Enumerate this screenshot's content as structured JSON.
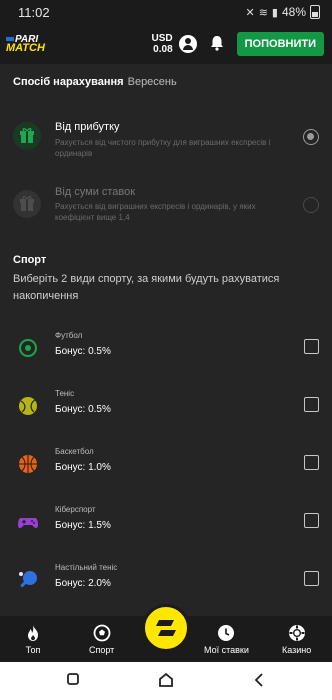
{
  "status_bar": {
    "time": "11:02",
    "battery": "48%"
  },
  "header": {
    "logo_top": "PARI",
    "logo_bottom": "MATCH",
    "currency": "USD",
    "balance": "0.08",
    "topup_label": "ПОПОВНИТИ"
  },
  "accrual": {
    "title": "Спосіб нарахування",
    "month": "Вересень",
    "options": [
      {
        "title": "Від прибутку",
        "desc": "Рахується від чистого прибутку для виграшних експресів і ординарів",
        "selected": true
      },
      {
        "title": "Від суми ставок",
        "desc": "Рахується від виграшних експресів і ординарів, у яких коефіцієнт вище 1,4",
        "selected": false
      }
    ]
  },
  "sport": {
    "title": "Спорт",
    "desc": "Виберіть 2 види спорту, за якими будуть рахуватися накопичення",
    "items": [
      {
        "name": "Футбол",
        "bonus": "Бонус: 0.5%",
        "icon": "football-icon",
        "color": "#18a84a"
      },
      {
        "name": "Теніс",
        "bonus": "Бонус: 0.5%",
        "icon": "tennis-icon",
        "color": "#b5b51a"
      },
      {
        "name": "Баскетбол",
        "bonus": "Бонус: 1.0%",
        "icon": "basketball-icon",
        "color": "#e2641d"
      },
      {
        "name": "Кіберспорт",
        "bonus": "Бонус: 1.5%",
        "icon": "gamepad-icon",
        "color": "#9a3fd6"
      },
      {
        "name": "Настільний теніс",
        "bonus": "Бонус: 2.0%",
        "icon": "table-tennis-icon",
        "color": "#2f6fe0"
      }
    ]
  },
  "bottom_nav": {
    "items": [
      {
        "label": "Топ",
        "icon": "fire-icon"
      },
      {
        "label": "Спорт",
        "icon": "ball-icon"
      },
      {
        "label": "",
        "icon": "parimatch-logo-icon"
      },
      {
        "label": "Мої ставки",
        "icon": "clock-icon"
      },
      {
        "label": "Казино",
        "icon": "chip-icon"
      }
    ]
  }
}
